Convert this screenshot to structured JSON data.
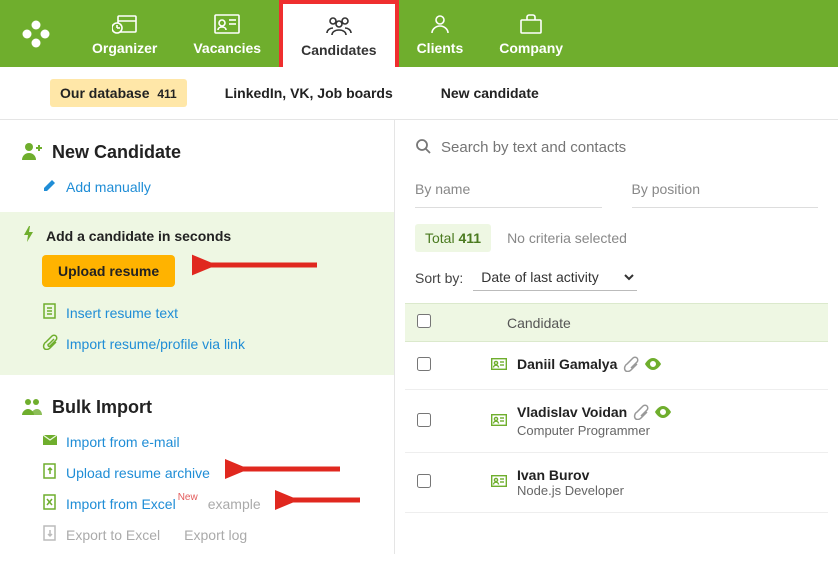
{
  "nav": {
    "organizer": "Organizer",
    "vacancies": "Vacancies",
    "candidates": "Candidates",
    "clients": "Clients",
    "company": "Company"
  },
  "subnav": {
    "our_db": "Our database",
    "our_db_count": "411",
    "sources": "LinkedIn, VK, Job boards",
    "new_candidate": "New candidate"
  },
  "left": {
    "new_candidate_h": "New Candidate",
    "add_manually": "Add manually",
    "add_seconds": "Add a candidate in seconds",
    "upload_resume": "Upload resume",
    "insert_text": "Insert resume text",
    "import_link": "Import resume/profile via link",
    "bulk_h": "Bulk Import",
    "import_email": "Import from e-mail",
    "upload_archive": "Upload resume archive",
    "import_excel": "Import from Excel",
    "new_badge": "New",
    "example": "example",
    "export_excel": "Export to Excel",
    "export_log": "Export log"
  },
  "right": {
    "search_placeholder": "Search by text and contacts",
    "by_name": "By name",
    "by_position": "By position",
    "total_label": "Total",
    "total_count": "411",
    "no_criteria": "No criteria selected",
    "sort_by": "Sort by:",
    "sort_value": "Date of last activity",
    "col_candidate": "Candidate",
    "rows": [
      {
        "name": "Daniil Gamalya",
        "role": "",
        "clip": true,
        "eye": true
      },
      {
        "name": "Vladislav Voidan",
        "role": "Computer Programmer",
        "clip": true,
        "eye": true
      },
      {
        "name": "Ivan Burov",
        "role": "Node.js Developer",
        "clip": false,
        "eye": false
      }
    ]
  }
}
